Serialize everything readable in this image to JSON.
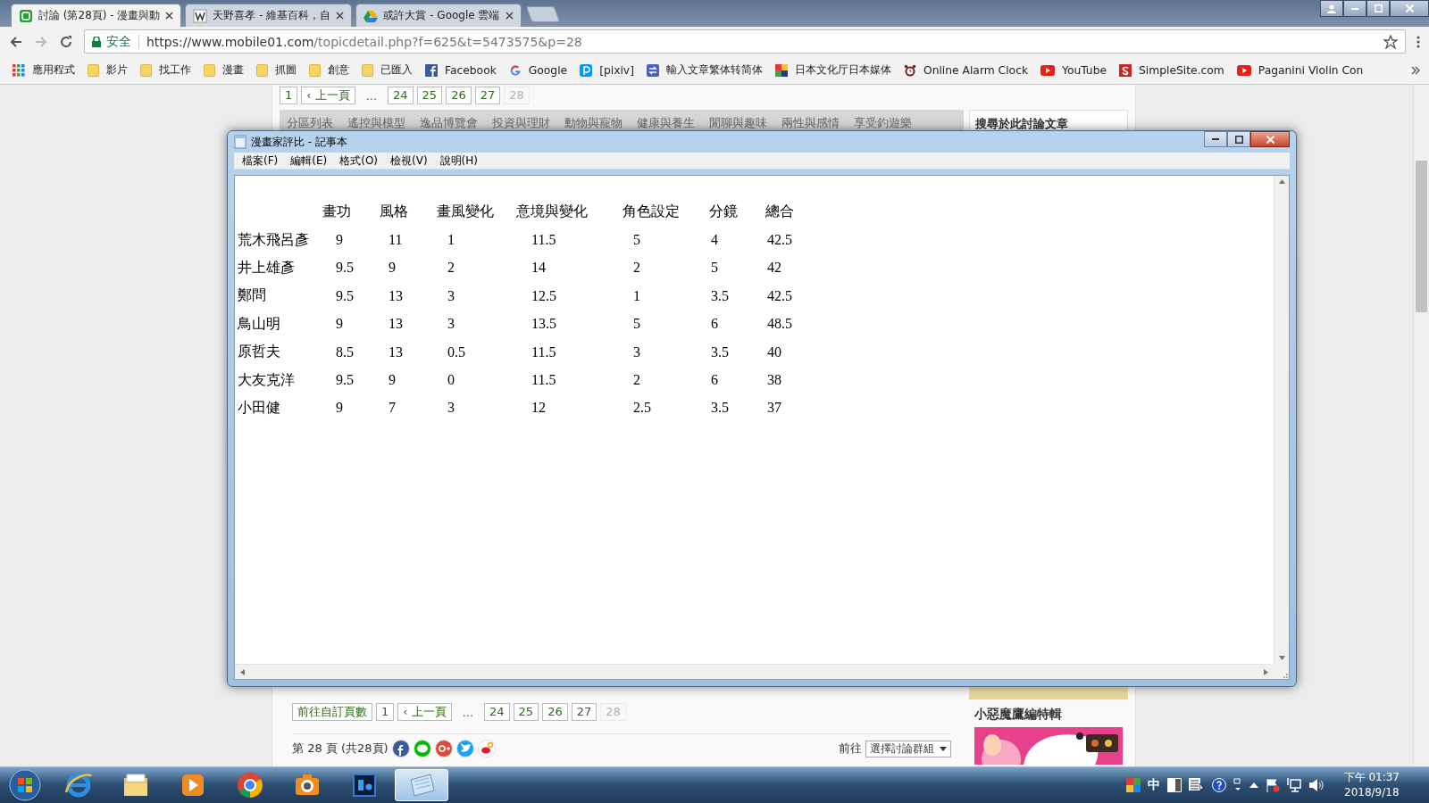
{
  "browser": {
    "tabs": [
      {
        "title": "討論 (第28頁) - 漫畫與動",
        "kind": "mobile01",
        "selected": true
      },
      {
        "title": "天野喜孝 - 維基百科，自",
        "kind": "wikipedia",
        "selected": false
      },
      {
        "title": "或許大賞 - Google 雲端",
        "kind": "drive",
        "selected": false
      }
    ],
    "address": {
      "secure_label": "安全",
      "host": "https://www.mobile01.com",
      "path": "/topicdetail.php?f=625&t=5473575&p=28"
    },
    "bookmarks": [
      {
        "label": "應用程式",
        "kind": "apps"
      },
      {
        "label": "影片",
        "kind": "folder"
      },
      {
        "label": "找工作",
        "kind": "folder"
      },
      {
        "label": "漫畫",
        "kind": "folder"
      },
      {
        "label": "抓圖",
        "kind": "folder"
      },
      {
        "label": "創意",
        "kind": "folder"
      },
      {
        "label": "已匯入",
        "kind": "folder"
      },
      {
        "label": "Facebook",
        "kind": "facebook"
      },
      {
        "label": "Google",
        "kind": "google"
      },
      {
        "label": "[pixiv]",
        "kind": "pixiv"
      },
      {
        "label": "輸入文章繁体转简体",
        "kind": "convert"
      },
      {
        "label": "日本文化厅日本媒体",
        "kind": "mosaic"
      },
      {
        "label": "Online Alarm Clock",
        "kind": "clock"
      },
      {
        "label": "YouTube",
        "kind": "youtube"
      },
      {
        "label": "SimpleSite.com",
        "kind": "simplesite"
      },
      {
        "label": "Paganini Violin Con",
        "kind": "youtube"
      }
    ]
  },
  "page": {
    "pager_top": [
      {
        "label": "1",
        "kind": "link",
        "selected": false
      },
      {
        "label": "‹ 上一頁",
        "kind": "link",
        "selected": false
      },
      {
        "label": "...",
        "kind": "ellipsis"
      },
      {
        "label": "24",
        "kind": "link",
        "selected": false
      },
      {
        "label": "25",
        "kind": "link",
        "selected": false
      },
      {
        "label": "26",
        "kind": "link",
        "selected": false
      },
      {
        "label": "27",
        "kind": "link",
        "selected": false
      },
      {
        "label": "28",
        "kind": "link",
        "selected": true
      }
    ],
    "forum_nav": [
      "分區列表",
      "遙控與模型",
      "逸品博覽會",
      "投資與理財",
      "動物與寵物",
      "健康與養生",
      "閒聊與趣味",
      "兩性與感情",
      "享受釣遊樂"
    ],
    "sidebar_heading": "搜尋於此討論文章",
    "pager_bottom": [
      {
        "label": "前往自訂頁數",
        "kind": "link",
        "selected": false
      },
      {
        "label": "1",
        "kind": "link",
        "selected": false
      },
      {
        "label": "‹ 上一頁",
        "kind": "link",
        "selected": false
      },
      {
        "label": "...",
        "kind": "ellipsis"
      },
      {
        "label": "24",
        "kind": "link",
        "selected": false
      },
      {
        "label": "25",
        "kind": "link",
        "selected": false
      },
      {
        "label": "26",
        "kind": "link",
        "selected": false
      },
      {
        "label": "27",
        "kind": "link",
        "selected": false
      },
      {
        "label": "28",
        "kind": "link",
        "selected": true
      }
    ],
    "page_info": "第 28 頁 (共28頁)",
    "share": [
      {
        "kind": "facebook"
      },
      {
        "kind": "line"
      },
      {
        "kind": "googleplus"
      },
      {
        "kind": "twitter"
      },
      {
        "kind": "weibo"
      }
    ],
    "goto_label": "前往",
    "group_select": "選擇討論群組",
    "promo_title": "小惡魔鷹編特輯"
  },
  "notepad": {
    "title": "漫畫家評比 - 記事本",
    "menu": [
      "檔案(F)",
      "編輯(E)",
      "格式(O)",
      "檢視(V)",
      "說明(H)"
    ],
    "columns": [
      "畫功",
      "風格",
      "畫風變化",
      "意境與變化",
      "角色設定",
      "分鏡",
      "總合"
    ],
    "rows": [
      {
        "name": "荒木飛呂彥",
        "values": [
          "9",
          "11",
          "1",
          "11.5",
          "5",
          "4",
          "42.5"
        ]
      },
      {
        "name": "井上雄彥",
        "values": [
          "9.5",
          "9",
          "2",
          "14",
          "2",
          "5",
          "42"
        ]
      },
      {
        "name": "鄭問",
        "values": [
          "9.5",
          "13",
          "3",
          "12.5",
          "1",
          "3.5",
          "42.5"
        ]
      },
      {
        "name": "鳥山明",
        "values": [
          "9",
          "13",
          "3",
          "13.5",
          "5",
          "6",
          "48.5"
        ]
      },
      {
        "name": "原哲夫",
        "values": [
          "8.5",
          "13",
          "0.5",
          "11.5",
          "3",
          "3.5",
          "40"
        ]
      },
      {
        "name": "大友克洋",
        "values": [
          "9.5",
          "9",
          "0",
          "11.5",
          "2",
          "6",
          "38"
        ]
      },
      {
        "name": "小田健",
        "values": [
          "9",
          "7",
          "3",
          "12",
          "2.5",
          "3.5",
          "37"
        ]
      }
    ]
  },
  "taskbar": {
    "apps": [
      {
        "kind": "ie",
        "selected": false
      },
      {
        "kind": "explorer",
        "selected": false
      },
      {
        "kind": "media",
        "selected": false
      },
      {
        "kind": "chrome",
        "selected": false
      },
      {
        "kind": "camera",
        "selected": false
      },
      {
        "kind": "photoshop",
        "selected": false
      },
      {
        "kind": "notepad",
        "selected": true
      }
    ],
    "ime": "中",
    "time": "下午 01:37",
    "date": "2018/9/18"
  }
}
